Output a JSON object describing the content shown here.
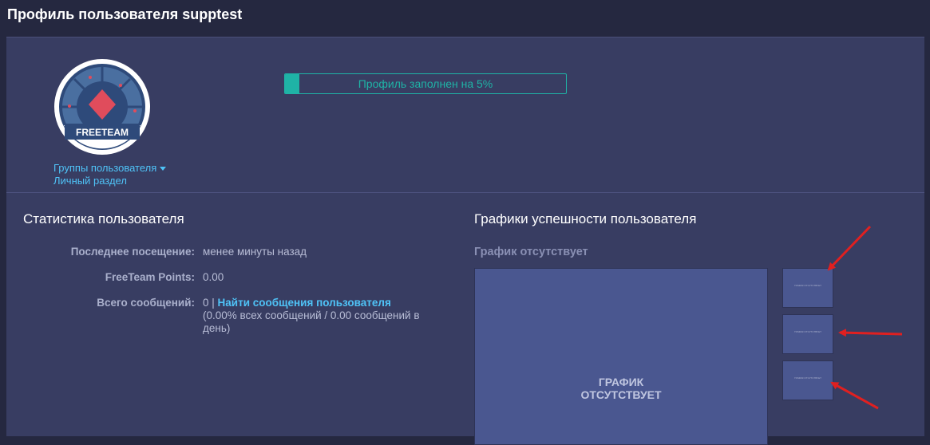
{
  "page": {
    "title": "Профиль пользователя supptest"
  },
  "avatar": {
    "text": "FREETEAM"
  },
  "profile": {
    "groups_link": "Группы пользователя",
    "personal_link": "Личный раздел",
    "completion_text": "Профиль заполнен на 5%",
    "completion_percent": 5
  },
  "stats": {
    "title": "Статистика пользователя",
    "rows": [
      {
        "label": "Последнее посещение:",
        "value": "менее минуты назад"
      },
      {
        "label": "FreeTeam Points:",
        "value": "0.00"
      },
      {
        "label": "Всего сообщений:",
        "value_prefix": "0 | ",
        "link": "Найти сообщения пользователя",
        "value_suffix": "(0.00% всех сообщений / 0.00 сообщений в день)"
      }
    ]
  },
  "charts": {
    "title": "Графики успешности пользователя",
    "missing_label": "График отсутствует",
    "main_placeholder": "ГРАФИК ОТСУТСТВУЕТ",
    "thumb_placeholder": "ГРАФИК ОТСУТСТВУЕТ"
  },
  "colors": {
    "background": "#252840",
    "panel": "#383d62",
    "accent_link": "#4fc3f7",
    "progress": "#1fb3a6",
    "chart_placeholder": "#4a5790",
    "annotation_arrow": "#e02020"
  }
}
